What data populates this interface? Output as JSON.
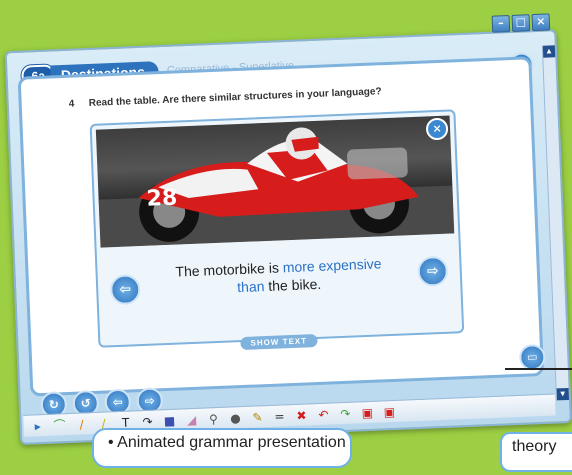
{
  "window": {
    "controls": [
      "–",
      "□",
      "×"
    ]
  },
  "header": {
    "unit": "6a",
    "title": "Destinations",
    "subtitle": "Comparative - Superlative"
  },
  "task": {
    "number": "4",
    "instruction": "Read the table. Are there similar structures in your language?"
  },
  "popup": {
    "close": "×",
    "sentence": {
      "part1": "The motorbike is ",
      "highlight1": "more expensive",
      "highlight2": "than",
      "part2": " the bike."
    },
    "prev": "⇦",
    "next": "⇨",
    "show_text": "SHOW TEXT"
  },
  "bottom_nav": {
    "buttons": [
      "↻",
      "↺",
      "⇦",
      "⇨"
    ]
  },
  "scroll": {
    "up": "▲",
    "down": "▼"
  },
  "toolbar": {
    "tools": [
      "▸",
      "⌒",
      "/",
      "/",
      "T",
      "↷",
      "■",
      "◢",
      "⚲",
      "●",
      "✎",
      "=",
      "✖",
      "↶",
      "↷",
      "▣",
      "▣"
    ]
  },
  "captions": {
    "left": "• Animated grammar presentation",
    "right": "theory"
  },
  "colors": {
    "background": "#9ccf43",
    "accent": "#2c72bd",
    "highlight_text": "#2b72c6"
  }
}
